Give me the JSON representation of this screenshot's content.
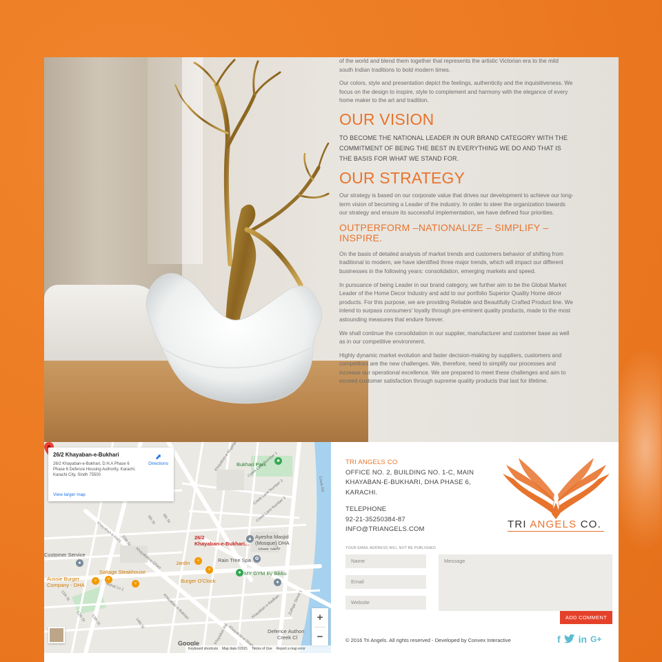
{
  "hero": {
    "intro_tail": "of the world and blend them together that represents the artistic Victorian era to the mild south Indian traditions to bold modern times.",
    "intro_colors": "Our colors, style and presentation depict the feelings, authenticity and the inquisitiveness. We focus on the design to inspire, style to complement and harmony with the elegance of every home maker to the art and tradition.",
    "vision_title": "OUR VISION",
    "vision_text": "TO BECOME THE NATIONAL LEADER IN OUR BRAND CATEGORY WITH THE COMMITMENT OF BEING THE BEST IN EVERYTHING WE DO AND THAT IS THE BASIS FOR WHAT WE STAND FOR.",
    "strategy_title": "OUR STRATEGY",
    "strategy_text": "Our strategy is based on our corporate value that drives our development to achieve our long-term vision of becoming a Leader of the industry. In order to steer the organization towards our strategy and ensure its successful implementation, we have defined four priorities.",
    "priorities_title": "OUTPERFORM –NATIONALIZE – SIMPLIFY – INSPIRE.",
    "p1": "On the basis of detailed analysis of market trends and customers behavior of shifting from traditional to modern, we have identified three major trends, which will impact our different businesses in the following years: consolidation, emerging markets and speed.",
    "p2": "In pursuance of being Leader in our brand category, we further aim to be the Global Market Leader of the Home Decor Industry and add to our portfolio Superior Quality Home décor products. For this purpose, we are providing Reliable and Beautifully Crafted Product line. We intend to surpass consumers' loyalty through pre-eminent quality products, made to the most astounding measures that endure forever.",
    "p3": "We shall continue the consolidation in our supplier, manufacturer and customer base as well as in our competitive environment.",
    "p4": "Highly dynamic market evolution and faster decision-making by suppliers, customers and competitors are the new challenges. We, therefore, need to simplify our processes and increase our operational excellence. We are prepared to meet these challenges and aim to exceed customer satisfaction through supreme quality products that last for lifetime."
  },
  "map": {
    "card": {
      "place": "26/2 Khayaban-e-Bukhari",
      "address": "26/2 Khayaban-e-Bukhari, D.H.A Phase 6 Phase 6 Defence Housing Authority, Karachi, Karachi City, Sindh 75500",
      "directions": "Directions",
      "larger_map": "View larger map"
    },
    "labels": {
      "bukhari_park": "Bukhari Park",
      "pin_line1": "26/2",
      "pin_line2": "Khayaban-e-Bukhari...",
      "masjid_line1": "Ayesha Masjid",
      "masjid_line2": "(Mosque) DHA",
      "masjid_urdu": "عائشہ مسجد",
      "customer_service": "Customer Service",
      "saltage": "Saltage Steakhouse",
      "jardin": "Jardin",
      "rain_tree": "Rain Tree Spa",
      "my_gym": "MY GYM By Bikku",
      "burger_oclock": "Burger O'Clock",
      "aussie_line1": "Aussie Burger",
      "aussie_line2": "Company - DHA",
      "defence_line1": "Defence Authori",
      "defence_line2": "Creek Cl",
      "google": "Google"
    },
    "streets": [
      "Khayaban-e-Mujahid",
      "8th St",
      "9th St",
      "10th St",
      "11th St",
      "12th St",
      "13th St",
      "14th St",
      "Creek Lane Number 1",
      "Creek Lane Number 2",
      "Creek Lane Number 3",
      "Creek Rd",
      "Khayaban-e-Hafiz",
      "Khayaban-e-Ghazi",
      "Khayaban-e-Bukhari",
      "Zulfiqar Street 1",
      "Khayaban-e-Badban",
      "Nishat Ln 1",
      "Khayaban Rd",
      "Khayaban-e-Shaheen"
    ],
    "footer": {
      "shortcuts": "Keyboard shortcuts",
      "mapdata": "Map data ©2021",
      "terms": "Terms of Use",
      "report": "Report a map error"
    },
    "zoom_in": "+",
    "zoom_out": "−"
  },
  "contact": {
    "company": "TRI ANGELS CO",
    "address_1": "OFFICE NO. 2, BUILDING NO. 1-C, MAIN",
    "address_2": "KHAYABAN-E-BUKHARI, DHA PHASE 6,",
    "address_3": "KARACHI.",
    "telephone_label": "TELEPHONE",
    "telephone": "92-21-35250384-87",
    "email": "INFO@TRIANGELS.COM",
    "logo_text_1": "TRI ",
    "logo_text_2": "ANGELS",
    "logo_text_3": " CO.",
    "notice": "YOUR EMAIL ADDRESS WILL NOT BE PUBLISHED.",
    "name_placeholder": "Name",
    "email_placeholder": "Email",
    "website_placeholder": "Website",
    "message_placeholder": "Message",
    "submit": "ADD COMMENT",
    "copyright": "© 2016 Tri Angels. All rights reserved - Developed by Convex Interactive"
  },
  "social": [
    "facebook-icon",
    "twitter-icon",
    "linkedin-icon",
    "google-plus-icon"
  ],
  "colors": {
    "accent": "#e8732c",
    "button": "#e5412a",
    "social": "#5cbcd0",
    "page_bg": "#ec7a22"
  }
}
